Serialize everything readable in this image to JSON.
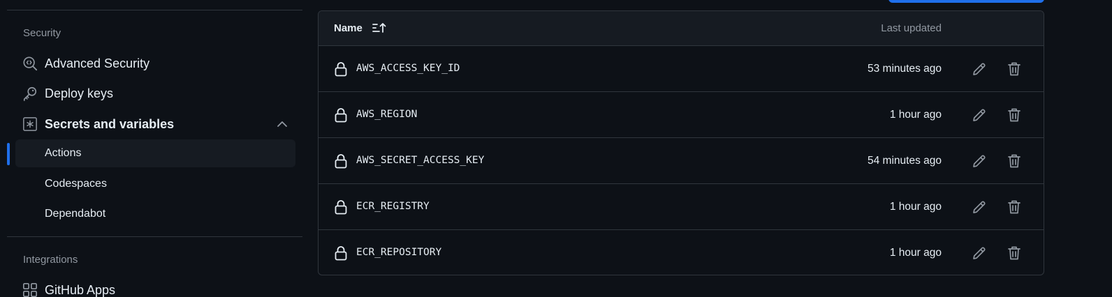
{
  "sidebar": {
    "security_title": "Security",
    "items": [
      {
        "label": "Advanced Security",
        "icon": "codescan-icon"
      },
      {
        "label": "Deploy keys",
        "icon": "key-icon"
      },
      {
        "label": "Secrets and variables",
        "icon": "asterisk-icon"
      }
    ],
    "subitems": [
      {
        "label": "Actions",
        "active": true
      },
      {
        "label": "Codespaces"
      },
      {
        "label": "Dependabot"
      }
    ],
    "integrations_title": "Integrations",
    "integrations_items": [
      {
        "label": "GitHub Apps",
        "icon": "apps-icon"
      }
    ]
  },
  "table": {
    "header_name": "Name",
    "header_updated": "Last updated",
    "rows": [
      {
        "name": "AWS_ACCESS_KEY_ID",
        "updated": "53 minutes ago"
      },
      {
        "name": "AWS_REGION",
        "updated": "1 hour ago"
      },
      {
        "name": "AWS_SECRET_ACCESS_KEY",
        "updated": "54 minutes ago"
      },
      {
        "name": "ECR_REGISTRY",
        "updated": "1 hour ago"
      },
      {
        "name": "ECR_REPOSITORY",
        "updated": "1 hour ago"
      }
    ]
  },
  "colors": {
    "background": "#0d1117",
    "border": "#30363d",
    "accent": "#1f6feb",
    "muted_text": "#9198a1"
  }
}
